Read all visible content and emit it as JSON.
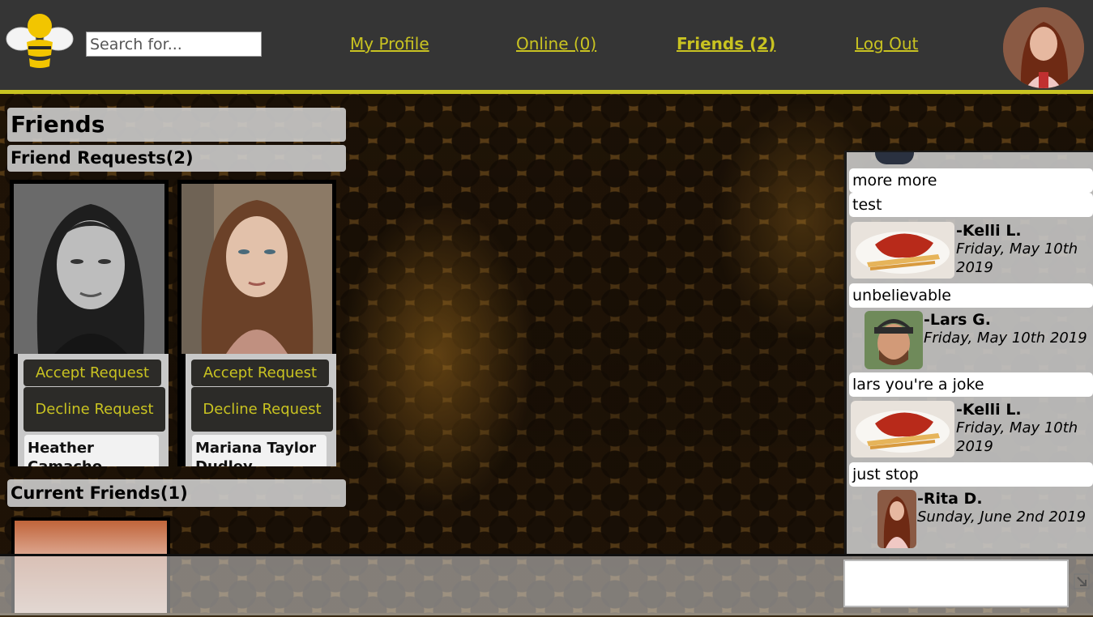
{
  "header": {
    "search_placeholder": "Search for...",
    "nav": {
      "profile": "My Profile",
      "online": "Online (0)",
      "friends": "Friends (2)",
      "logout": "Log Out"
    },
    "accent_color": "#c9c321"
  },
  "friends_page": {
    "title": "Friends",
    "requests_title": "Friend Requests(2)",
    "requests": [
      {
        "name": "Heather Camacho",
        "accept_label": "Accept Request",
        "decline_label": "Decline Request"
      },
      {
        "name": "Mariana Taylor Dudley",
        "accept_label": "Accept Request",
        "decline_label": "Decline Request"
      }
    ],
    "current_title": "Current Friends(1)"
  },
  "chat": {
    "messages": [
      {
        "text": "more more"
      },
      {
        "text": "test"
      },
      {
        "author": "-Kelli L.",
        "date": "Friday, May 10th 2019"
      },
      {
        "text": "unbelievable"
      },
      {
        "author": "-Lars G.",
        "date": "Friday, May 10th 2019"
      },
      {
        "text": "lars you're a joke"
      },
      {
        "author": "-Kelli L.",
        "date": "Friday, May 10th 2019"
      },
      {
        "text": "just stop"
      },
      {
        "author": "-Rita D.",
        "date": "Sunday, June 2nd 2019"
      }
    ]
  }
}
